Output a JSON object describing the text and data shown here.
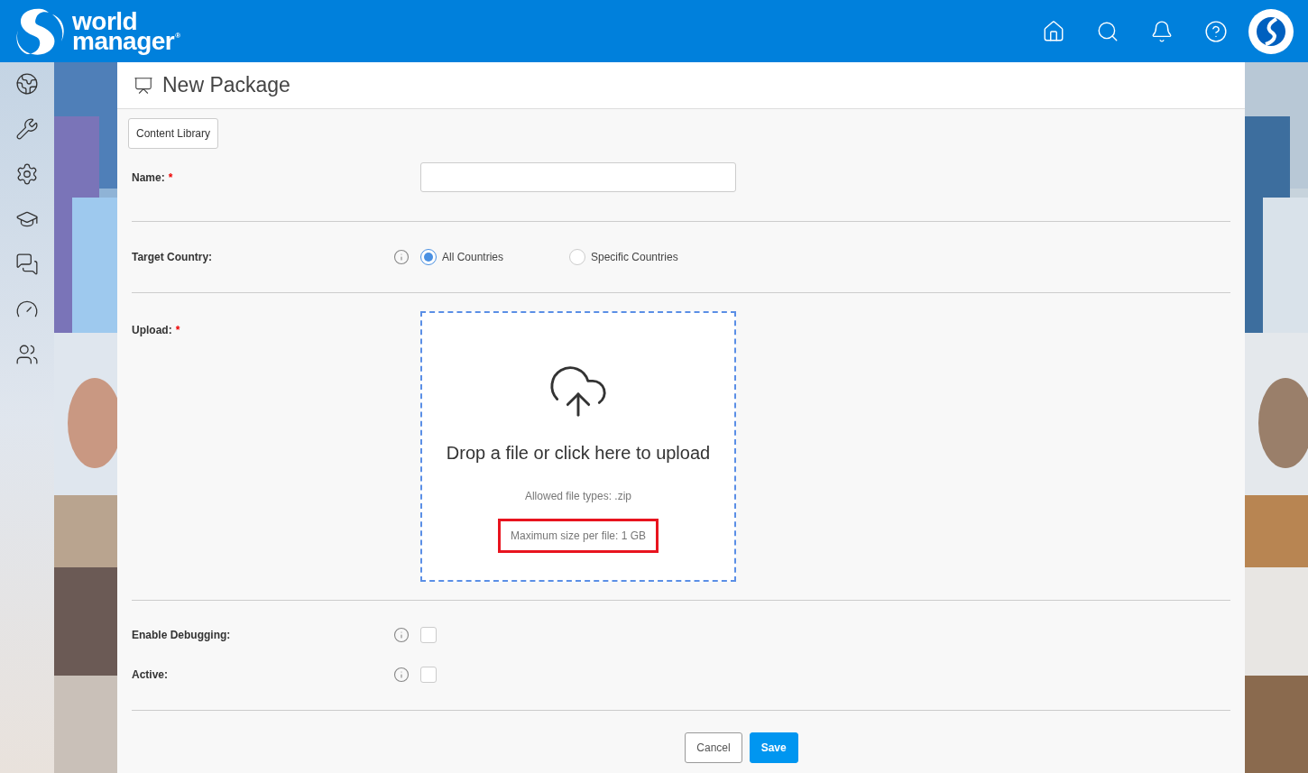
{
  "header": {
    "logo_line1": "world",
    "logo_line2": "manager",
    "logo_mark": "®"
  },
  "page": {
    "title": "New Package"
  },
  "library_button": "Content Library",
  "sections": [
    [
      {
        "kind": "text",
        "label": "Name:",
        "required_mark": "*"
      }
    ],
    [
      {
        "kind": "radio",
        "label": "Target Country:",
        "info": true,
        "options": [
          {
            "label": "All Countries",
            "selected": true
          },
          {
            "label": "Specific Countries",
            "selected": false
          }
        ]
      }
    ],
    [
      {
        "kind": "upload",
        "label": "Upload:",
        "required_mark": "*",
        "prompt": "Drop a file or click here to upload",
        "notes": [
          {
            "text": "Allowed file types: .zip",
            "highlighted": false
          },
          {
            "text": "Maximum size per file: 1 GB",
            "highlighted": true
          }
        ]
      }
    ],
    [
      {
        "kind": "checkbox",
        "label": "Enable Debugging:",
        "info": true,
        "checked": false
      },
      {
        "kind": "checkbox",
        "label": "Active:",
        "info": true,
        "checked": false
      }
    ]
  ],
  "buttons": [
    {
      "label": "Cancel",
      "kind": "secondary"
    },
    {
      "label": "Save",
      "kind": "primary"
    }
  ]
}
